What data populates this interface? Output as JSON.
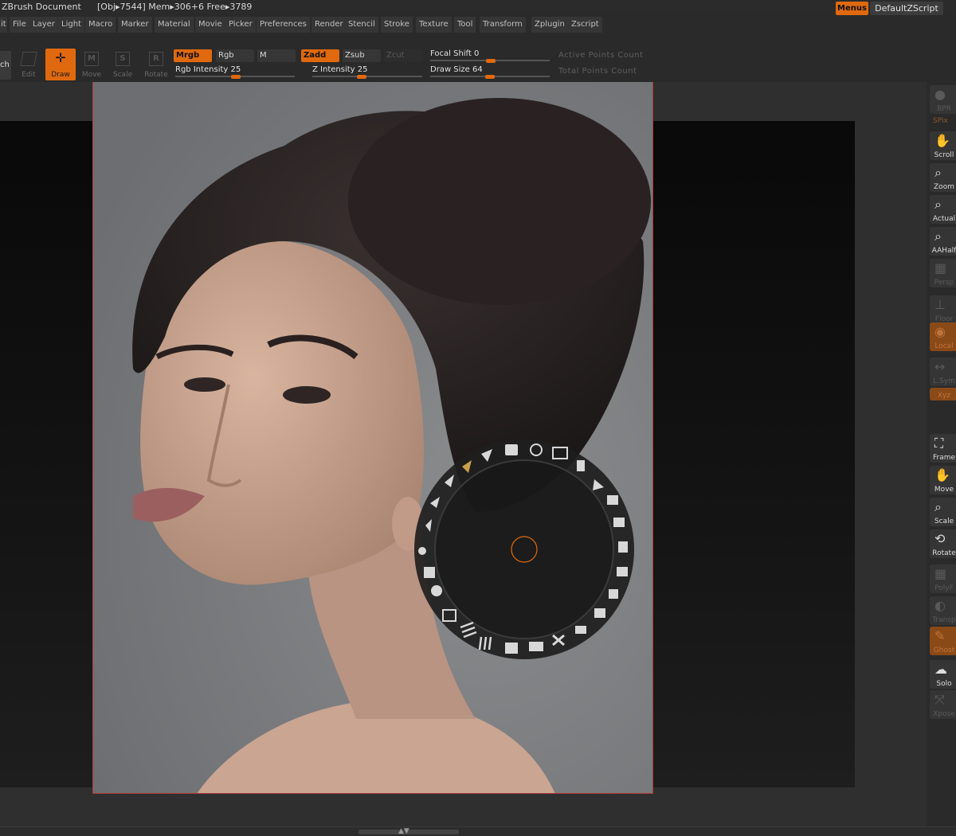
{
  "titlebar": {
    "app_title": "ZBrush Document",
    "stats": "[Obj▸7544] Mem▸306+6 Free▸3789",
    "menus_label": "Menus",
    "zscript_label": "DefaultZScript"
  },
  "menus": [
    "it",
    "File",
    "Layer",
    "Light",
    "Macro",
    "Marker",
    "Material",
    "Movie",
    "Picker",
    "Preferences",
    "Render",
    "Stencil",
    "Stroke",
    "Texture",
    "Tool",
    "Transform",
    "Zplugin",
    "Zscript"
  ],
  "toolbar": {
    "partial_label": "ch",
    "edit_label": "Edit",
    "draw_label": "Draw",
    "move_label": "Move",
    "scale_label": "Scale",
    "rotate_label": "Rotate",
    "move_glyph": "M",
    "scale_glyph": "S",
    "rotate_glyph": "R",
    "mrgb": "Mrgb",
    "rgb": "Rgb",
    "m": "M",
    "zadd": "Zadd",
    "zsub": "Zsub",
    "zcut": "Zcut",
    "rgb_intensity": "Rgb Intensity 25",
    "rgb_intensity_value": 25,
    "z_intensity": "Z Intensity 25",
    "z_intensity_value": 25,
    "focal_shift": "Focal Shift 0",
    "focal_shift_value": 0,
    "draw_size": "Draw Size 64",
    "draw_size_value": 64,
    "active_points": "Active Points Count",
    "total_points": "Total Points Count"
  },
  "right_shelf": {
    "bpr": "BPR",
    "spix": "SPix",
    "scroll": "Scroll",
    "zoom": "Zoom",
    "actual": "Actual",
    "aahalf": "AAHalf",
    "persp": "Persp",
    "floor": "Floor",
    "local": "Local",
    "lsym": "L.Sym",
    "xyz": "Xyz",
    "frame": "Frame",
    "move": "Move",
    "scale": "Scale",
    "rotate": "Rotate",
    "polyf": "PolyF",
    "transp": "Transp",
    "ghost": "Ghost",
    "solo": "Solo",
    "xpose": "Xpose"
  },
  "colors": {
    "accent": "#e0690f",
    "panel": "#2a2a2a",
    "button": "#353535"
  }
}
